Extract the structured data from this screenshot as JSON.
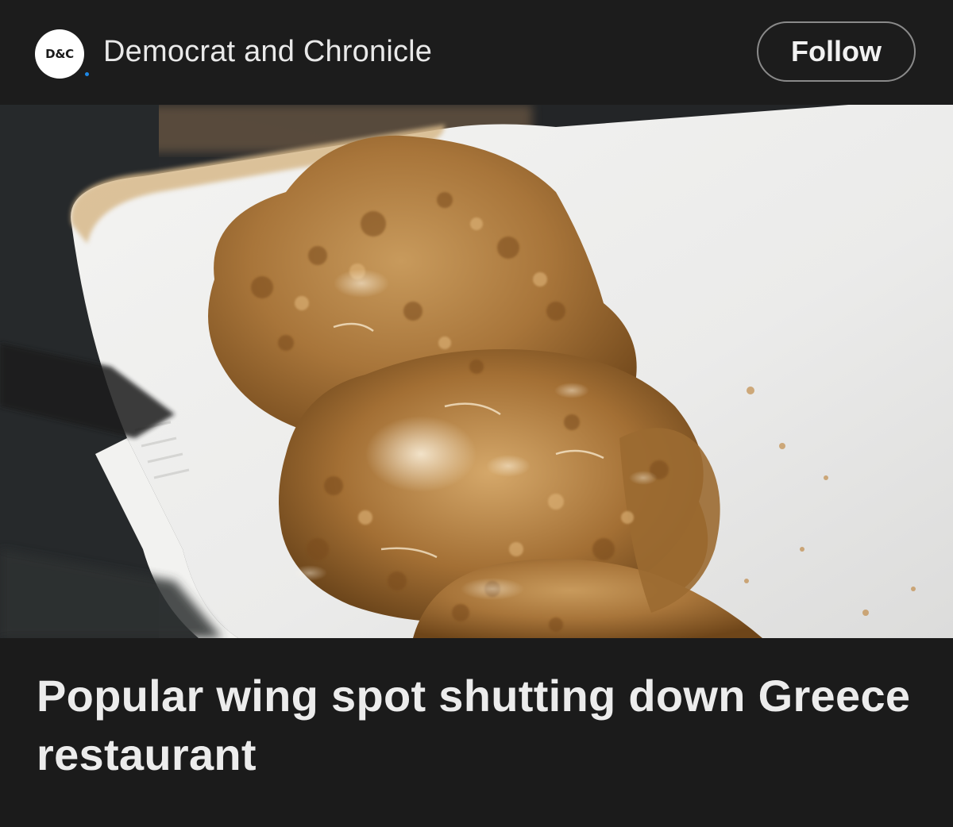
{
  "header": {
    "logo_text": "D&C",
    "logo_dot_color": "#1e88e5",
    "publisher_name": "Democrat and Chronicle",
    "follow_label": "Follow"
  },
  "photo": {
    "description_icon": "photo-of-glazed-chicken-wings-in-takeout-container"
  },
  "article": {
    "headline": "Popular wing spot shutting down Greece restaurant"
  }
}
